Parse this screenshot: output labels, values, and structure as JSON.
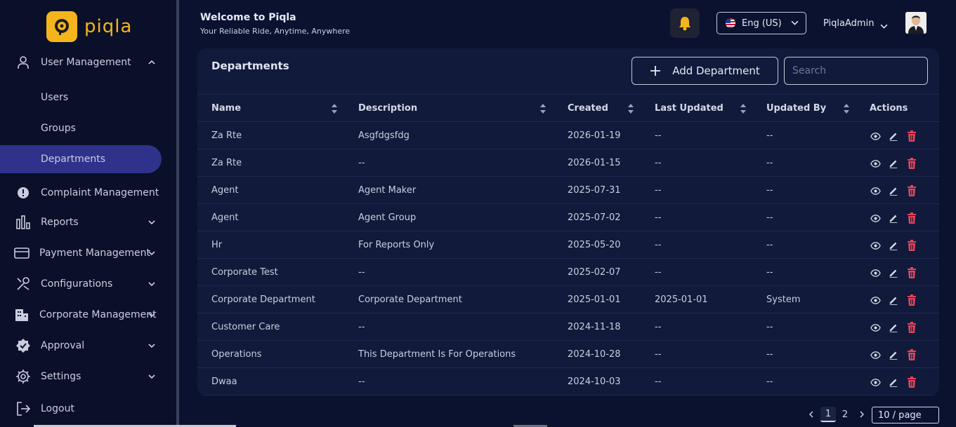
{
  "app": {
    "name": "piqla"
  },
  "header": {
    "title": "Welcome to Piqla",
    "subtitle": "Your Reliable Ride, Anytime, Anywhere",
    "language": "Eng (US)",
    "user_name": "PiqlaAdmin"
  },
  "sidebar": {
    "items": [
      {
        "label": "User Management",
        "icon": "user-icon"
      },
      {
        "label": "Users"
      },
      {
        "label": "Groups"
      },
      {
        "label": "Departments"
      },
      {
        "label": "Complaint Management",
        "icon": "alert-icon"
      },
      {
        "label": "Reports",
        "icon": "bar-chart-icon"
      },
      {
        "label": "Payment Management",
        "icon": "credit-card-icon"
      },
      {
        "label": "Configurations",
        "icon": "tools-icon"
      },
      {
        "label": "Corporate Management",
        "icon": "building-icon"
      },
      {
        "label": "Approval",
        "icon": "badge-check-icon"
      },
      {
        "label": "Settings",
        "icon": "gear-icon"
      },
      {
        "label": "Logout",
        "icon": "logout-icon"
      }
    ]
  },
  "page": {
    "title": "Departments",
    "add_button": "Add Department",
    "search_placeholder": "Search"
  },
  "table": {
    "columns": [
      "Name",
      "Description",
      "Created",
      "Last Updated",
      "Updated By",
      "Actions"
    ],
    "rows": [
      [
        "Za Rte",
        "Asgfdgsfdg",
        "2026-01-19",
        "--",
        "--"
      ],
      [
        "Za Rte",
        "--",
        "2026-01-15",
        "--",
        "--"
      ],
      [
        "Agent",
        "Agent Maker",
        "2025-07-31",
        "--",
        "--"
      ],
      [
        "Agent",
        "Agent Group",
        "2025-07-02",
        "--",
        "--"
      ],
      [
        "Hr",
        "For Reports Only",
        "2025-05-20",
        "--",
        "--"
      ],
      [
        "Corporate Test",
        "--",
        "2025-02-07",
        "--",
        "--"
      ],
      [
        "Corporate Department",
        "Corporate Department",
        "2025-01-01",
        "2025-01-01",
        "System"
      ],
      [
        "Customer Care",
        "--",
        "2024-11-18",
        "--",
        "--"
      ],
      [
        "Operations",
        "This Department Is For Operations",
        "2024-10-28",
        "--",
        "--"
      ],
      [
        "Dwaa",
        "--",
        "2024-10-03",
        "--",
        "--"
      ]
    ]
  },
  "pagination": {
    "pages": [
      "1",
      "2"
    ],
    "current": "1",
    "per_page": "10 / page"
  },
  "colors": {
    "accent": "#f3b51b",
    "active_nav": "#2f318a",
    "delete": "#e8445a"
  }
}
